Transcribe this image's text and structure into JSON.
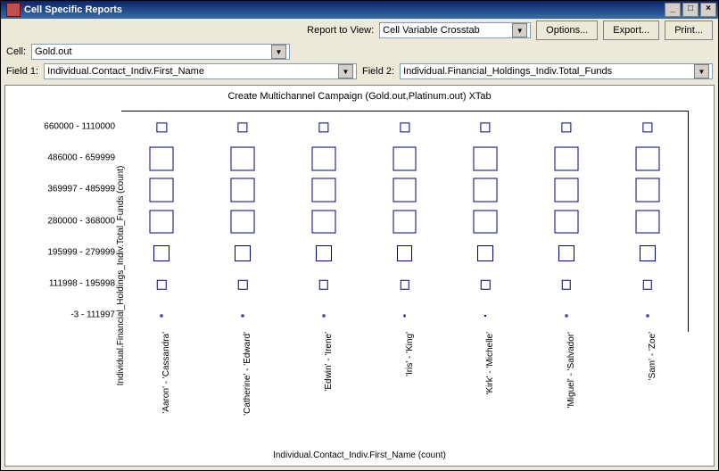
{
  "window": {
    "title": "Cell Specific Reports"
  },
  "toolbar": {
    "report_label": "Report to View:",
    "report_value": "Cell Variable Crosstab",
    "options": "Options...",
    "export": "Export...",
    "print": "Print..."
  },
  "cell": {
    "label": "Cell:",
    "value": "Gold.out"
  },
  "fields": {
    "f1_label": "Field 1:",
    "f1_value": "Individual.Contact_Indiv.First_Name",
    "f2_label": "Field 2:",
    "f2_value": "Individual.Financial_Holdings_Indiv.Total_Funds"
  },
  "winbtn": {
    "min": "_",
    "max": "□",
    "close": "×"
  },
  "chart_data": {
    "type": "heatmap",
    "title": "Create Multichannel Campaign (Gold.out,Platinum.out) XTab",
    "xlabel": "Individual.Contact_Indiv.First_Name (count)",
    "ylabel": "Individual.Financial_Holdings_Indiv.Total_Funds (count)",
    "x_categories": [
      "'Aaron' - 'Cassandra'",
      "'Catherine' - 'Edward'",
      "'Edwin' - 'Irene'",
      "'Iris' - 'King'",
      "'Kirk' - 'Michelle'",
      "'Miguel' - 'Salvador'",
      "'Sam' - 'Zoe'"
    ],
    "y_categories": [
      "660000 - 1110000",
      "486000 - 659999",
      "369997 - 485999",
      "280000 - 368000",
      "195999 - 279999",
      "111998 - 195998",
      "-3 - 111997"
    ],
    "values": [
      [
        15,
        15,
        15,
        15,
        15,
        15,
        15
      ],
      [
        36,
        36,
        36,
        36,
        36,
        36,
        36
      ],
      [
        36,
        36,
        36,
        36,
        36,
        36,
        36
      ],
      [
        36,
        36,
        36,
        36,
        36,
        36,
        36
      ],
      [
        24,
        24,
        24,
        24,
        24,
        24,
        24
      ],
      [
        14,
        14,
        14,
        14,
        14,
        14,
        14
      ],
      [
        4,
        4,
        4,
        4,
        2,
        4,
        4
      ]
    ],
    "size_scale_max": 40
  }
}
